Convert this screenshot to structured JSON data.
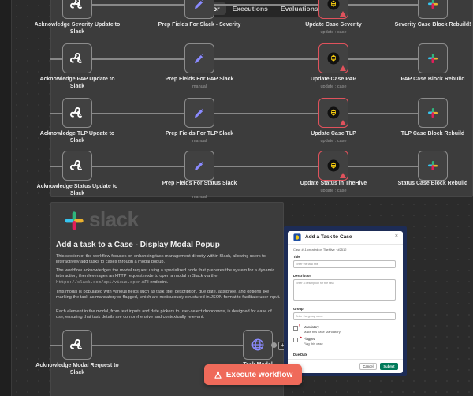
{
  "header": {
    "tabs": [
      {
        "label": "Editor"
      },
      {
        "label": "Executions"
      },
      {
        "label": "Evaluations"
      }
    ]
  },
  "rows": [
    {
      "ack": {
        "label": "Acknowledge Severity Update to Slack"
      },
      "prep": {
        "label": "Prep Fields For Slack - Severity",
        "sub": ""
      },
      "update": {
        "label": "Update Case Severity",
        "sub": "update : case"
      },
      "rebuild": {
        "label": "Severity Case Block Rebuild!"
      }
    },
    {
      "ack": {
        "label": "Acknowledge PAP Update to Slack"
      },
      "prep": {
        "label": "Prep Fields For PAP Slack",
        "sub": "manual"
      },
      "update": {
        "label": "Update Case PAP",
        "sub": "update : case"
      },
      "rebuild": {
        "label": "PAP Case Block Rebuild"
      }
    },
    {
      "ack": {
        "label": "Acknowledge TLP Update to Slack"
      },
      "prep": {
        "label": "Prep Fields For TLP Slack",
        "sub": "manual"
      },
      "update": {
        "label": "Update Case TLP",
        "sub": "update : case"
      },
      "rebuild": {
        "label": "TLP Case Block Rebuild"
      }
    },
    {
      "ack": {
        "label": "Acknowledge Status Update to Slack"
      },
      "prep": {
        "label": "Prep Fields For Status Slack",
        "sub": "manual"
      },
      "update": {
        "label": "Update Status in TheHive",
        "sub": "update : case"
      },
      "rebuild": {
        "label": "Status Case Block Rebuild"
      }
    }
  ],
  "section": {
    "logo_text": "slack",
    "title": "Add a task to a Case - Display Modal Popup",
    "p1": "This section of the workflow focuses on enhancing task management directly within Slack, allowing users to interactively add tasks to cases through a modal popup.",
    "p2_a": "The workflow acknowledges the modal request using a specialized node that prepares the system for a dynamic interaction, then leverages an HTTP request node to open a modal in Slack via the",
    "p2_code": "https://slack.com/api/views.open",
    "p2_b": "API endpoint.",
    "p3": "This modal is populated with various fields such as task title, description, due date, assignee, and options like marking the task as mandatory or flagged, which are meticulously structured in JSON format to facilitate user input.",
    "p4": "Each element in the modal, from text inputs and date pickers to user-select dropdowns, is designed for ease of use, ensuring that task details are comprehensive and contextually relevant."
  },
  "bottom_nodes": {
    "ack_modal": {
      "label": "Acknowledge Modal Request to Slack"
    },
    "task_modal": {
      "label": "Task Modal"
    }
  },
  "modal": {
    "title": "Add a Task to Case",
    "close": "×",
    "case_line": "Case #11 created on TheHive · #2512",
    "fields": [
      {
        "label": "Title",
        "placeholder": "Enter the task title"
      },
      {
        "label": "Description",
        "placeholder": "Enter a description for the task"
      },
      {
        "label": "Group",
        "placeholder": "Enter the group name"
      }
    ],
    "options": [
      {
        "label": "Mandatory",
        "hint": "Make this case Mandatory"
      },
      {
        "label": "Flagged",
        "hint": "Flag this case"
      }
    ],
    "due_date_label": "Due Date",
    "cancel": "Cancel",
    "submit": "Submit"
  },
  "actions": {
    "plus": "+",
    "execute": "Execute workflow"
  },
  "colors": {
    "accent": "#ef6a5a",
    "error": "#e0525c",
    "submit": "#007a5a",
    "modal_frame": "#1d2c56"
  }
}
